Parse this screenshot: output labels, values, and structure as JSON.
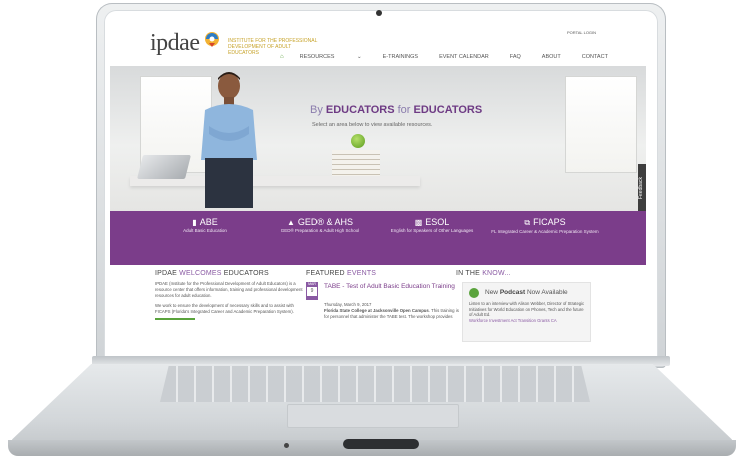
{
  "site": {
    "logo_text": "ipdae",
    "tagline": "INSTITUTE FOR THE PROFESSIONAL DEVELOPMENT OF ADULT EDUCATORS",
    "portal_link": "PORTAL LOGIN",
    "nav": {
      "home_icon": "home-icon",
      "items": [
        "RESOURCES",
        "E-TRAININGS",
        "EVENT CALENDAR",
        "FAQ",
        "ABOUT",
        "CONTACT"
      ]
    }
  },
  "hero": {
    "title_prefix": "By",
    "title_accent1": "EDUCATORS",
    "title_middle": "for",
    "title_accent2": "EDUCATORS",
    "subtitle": "Select an area below to view available resources.",
    "feedback_tab": "Feedback"
  },
  "categories": [
    {
      "icon": "book-icon",
      "title": "ABE",
      "subtitle": "Adult Basic Education"
    },
    {
      "icon": "graduation-cap-icon",
      "title": "GED® & AHS",
      "subtitle": "GED® Preparation & Adult High School"
    },
    {
      "icon": "esol-icon",
      "title": "ESOL",
      "subtitle": "English for Speakers of Other Languages"
    },
    {
      "icon": "external-link-icon",
      "title": "FICAPS",
      "subtitle": "FL Integrated Career & Academic Preparation System"
    }
  ],
  "welcome": {
    "title_start": "IPDAE",
    "title_hl": "WELCOMES",
    "title_end": "EDUCATORS",
    "para1": "IPDAE (Institute for the Professional Development of Adult Educators) is a resource center that offers information, training and professional development resources for adult education.",
    "para2": "We work to ensure the development of necessary skills and to assist with FICAPS (Florida's Integrated Career and Academic Preparation System)."
  },
  "events": {
    "title_start": "FEATURED",
    "title_hl": "EVENTS",
    "month": "MAR",
    "day": "9",
    "event_title": "TABE - Test of Adult Basic Education Training",
    "date_line": "Thursday, March 9, 2017",
    "location": "Florida State College at Jacksonville Open Campus",
    "desc": ". This training is for personnel that administer the TABE test. The workshop provides"
  },
  "know": {
    "title_start": "IN THE",
    "title_hl": "KNOW...",
    "podcast_prefix": "New",
    "podcast_bold": "Podcast",
    "podcast_suffix": "Now Available",
    "text": "Listen to an interview with Alison Webber, Director of Strategic Initiatives for World Education on Phones, Tech and the future of Adult Ed.",
    "link": "Workforce Investment Act Transition Grants CA"
  }
}
